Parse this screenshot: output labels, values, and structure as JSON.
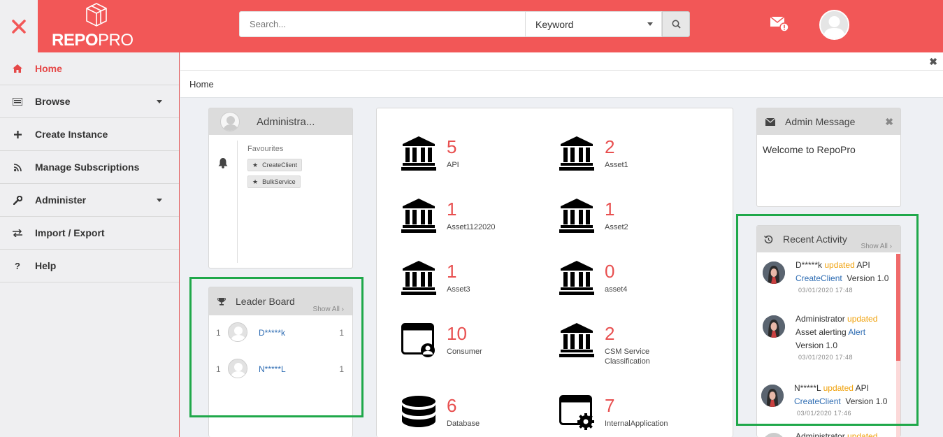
{
  "header": {
    "logo_bold": "REPO",
    "logo_light": "PRO",
    "search_placeholder": "Search...",
    "search_type": "Keyword"
  },
  "sidebar": {
    "items": [
      {
        "label": "Home",
        "icon": "home-icon"
      },
      {
        "label": "Browse",
        "icon": "list-icon"
      },
      {
        "label": "Create Instance",
        "icon": "plus-icon"
      },
      {
        "label": "Manage Subscriptions",
        "icon": "rss-icon"
      },
      {
        "label": "Administer",
        "icon": "wrench-icon"
      },
      {
        "label": "Import / Export",
        "icon": "exchange-icon"
      },
      {
        "label": "Help",
        "icon": "question-icon"
      }
    ]
  },
  "breadcrumb": "Home",
  "profile": {
    "title": "Administra...",
    "favourites_label": "Favourites",
    "favourites": [
      "CreateClient",
      "BulkService"
    ]
  },
  "leaderboard": {
    "title": "Leader Board",
    "show_all": "Show All",
    "rows": [
      {
        "rank": "1",
        "name": "D*****k",
        "score": "1"
      },
      {
        "rank": "1",
        "name": "N*****L",
        "score": "1"
      }
    ]
  },
  "stats": [
    {
      "count": "5",
      "label": "API",
      "icon": "bank-icon"
    },
    {
      "count": "2",
      "label": "Asset1",
      "icon": "bank-icon"
    },
    {
      "count": "1",
      "label": "Asset1122020",
      "icon": "bank-icon"
    },
    {
      "count": "1",
      "label": "Asset2",
      "icon": "bank-icon"
    },
    {
      "count": "1",
      "label": "Asset3",
      "icon": "bank-icon"
    },
    {
      "count": "0",
      "label": "asset4",
      "icon": "bank-icon"
    },
    {
      "count": "10",
      "label": "Consumer",
      "icon": "window-user-icon"
    },
    {
      "count": "2",
      "label": "CSM Service Classification",
      "icon": "bank-icon"
    },
    {
      "count": "6",
      "label": "Database",
      "icon": "database-icon"
    },
    {
      "count": "7",
      "label": "InternalApplication",
      "icon": "window-gear-icon"
    }
  ],
  "admin_message": {
    "title": "Admin Message",
    "text": "Welcome to RepoPro"
  },
  "recent_activity": {
    "title": "Recent Activity",
    "show_all": "Show All",
    "items": [
      {
        "user": "D*****k",
        "action": "updated",
        "line1_rest": "API",
        "link": "CreateClient",
        "rest": "Version 1.0",
        "date": "03/01/2020 17:48"
      },
      {
        "user": "Administrator",
        "action": "updated",
        "line1_rest": "",
        "prefix": "Asset alerting",
        "link": "Alert",
        "rest": "Version 1.0",
        "date": "03/01/2020 17:48"
      },
      {
        "user": "N*****L",
        "action": "updated",
        "line1_rest": "API",
        "link": "CreateClient",
        "rest": "Version 1.0",
        "date": "03/01/2020 17:46"
      },
      {
        "user": "Administrator",
        "action": "updated"
      }
    ]
  },
  "colors": {
    "brand": "#f25757",
    "accent_number": "#e85050",
    "link": "#2f6db3",
    "updated": "#f0a20d",
    "highlight": "#1fa84a"
  }
}
